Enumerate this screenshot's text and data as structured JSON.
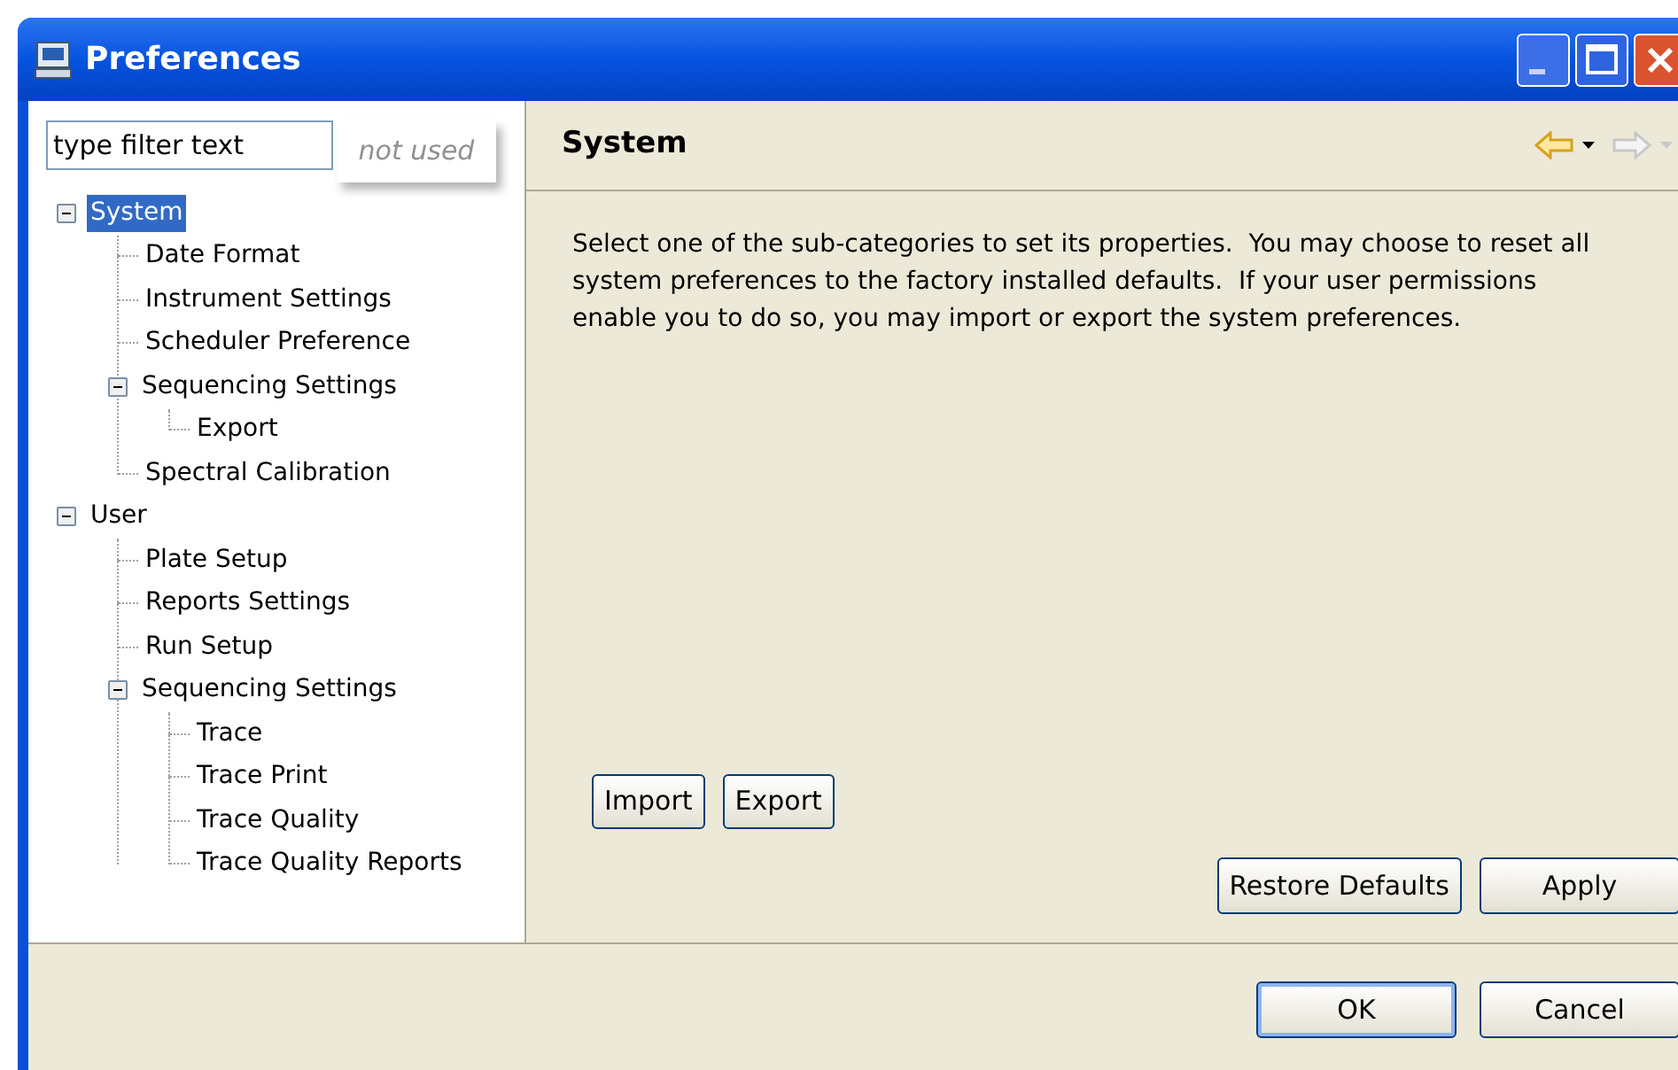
{
  "window": {
    "title": "Preferences",
    "controls": [
      {
        "kind": "minimize"
      },
      {
        "kind": "maximize"
      },
      {
        "kind": "close"
      }
    ]
  },
  "filter": {
    "value": "type filter text"
  },
  "callout": {
    "text": "not used"
  },
  "tree": [
    {
      "label": "System",
      "selected": true,
      "expanded": true,
      "children": [
        {
          "label": "Date Format",
          "selected": false
        },
        {
          "label": "Instrument Settings",
          "selected": false
        },
        {
          "label": "Scheduler Preference",
          "selected": false
        },
        {
          "label": "Sequencing Settings",
          "selected": false,
          "expanded": true,
          "children": [
            {
              "label": "Export",
              "selected": false
            }
          ]
        },
        {
          "label": "Spectral Calibration",
          "selected": false
        }
      ]
    },
    {
      "label": "User",
      "selected": false,
      "expanded": true,
      "children": [
        {
          "label": "Plate Setup",
          "selected": false
        },
        {
          "label": "Reports Settings",
          "selected": false
        },
        {
          "label": "Run Setup",
          "selected": false
        },
        {
          "label": "Sequencing Settings",
          "selected": false,
          "expanded": true,
          "children": [
            {
              "label": "Trace",
              "selected": false
            },
            {
              "label": "Trace Print",
              "selected": false
            },
            {
              "label": "Trace Quality",
              "selected": false
            },
            {
              "label": "Trace Quality Reports",
              "selected": false
            }
          ]
        }
      ]
    }
  ],
  "page": {
    "title": "System",
    "nav": [
      {
        "kind": "back",
        "disabled": false
      },
      {
        "kind": "forward",
        "disabled": true
      }
    ],
    "description": "Select one of the sub-categories to set its properties.  You may choose to reset all system preferences to the factory installed defaults.  If your user permissions enable you to do so, you may import or export the system preferences.",
    "actions": [
      "Import",
      "Export"
    ],
    "buttons": [
      "Restore Defaults",
      "Apply"
    ]
  },
  "dialog_buttons": [
    {
      "label": "OK",
      "default": true
    },
    {
      "label": "Cancel",
      "default": false
    }
  ]
}
